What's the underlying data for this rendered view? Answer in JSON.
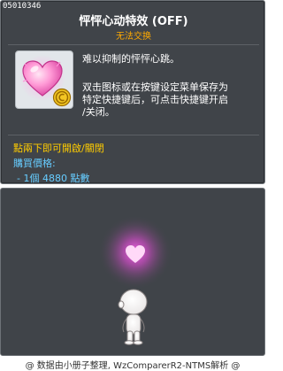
{
  "item": {
    "id": "05010346",
    "title": "怦怦心动特效 (OFF)",
    "trade_note": "无法交换"
  },
  "description": {
    "line1": "难以抑制的怦怦心跳。",
    "line2_parts": [
      "双击图标或在按键设定菜单保存为",
      "特定快捷键后，可点击快捷键开启",
      "/关闭。"
    ]
  },
  "hint": "點兩下即可開啟/關閉",
  "price": {
    "label": "購買價格:",
    "value": "- 1個 4880 點數"
  },
  "footer": "@ 数据由小册子整理, WzComparerR2-NTMS解析 @",
  "icons": {
    "item_icon": "pink-heart-icon",
    "coin_badge": "gold-coin-icon"
  },
  "colors": {
    "panel_bg": "#404449",
    "title": "#ffffff",
    "trade_note": "#ffaa00",
    "hint": "#ffcc00",
    "price": "#66ccff",
    "glow": "#ff55ee"
  }
}
